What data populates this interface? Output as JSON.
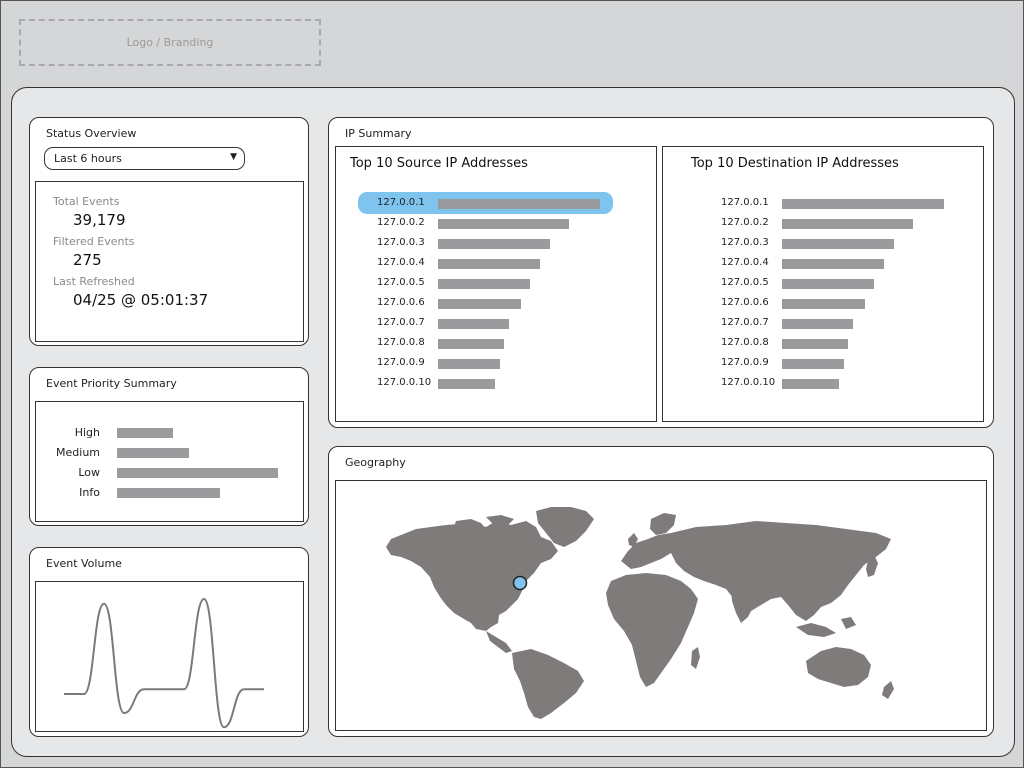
{
  "branding": {
    "logo_text": "Logo / Branding"
  },
  "status_overview": {
    "title": "Status Overview",
    "time_range": "Last 6 hours",
    "stats": [
      {
        "label": "Total Events",
        "value": "39,179"
      },
      {
        "label": "Filtered Events",
        "value": "275"
      },
      {
        "label": "Last Refreshed",
        "value": "04/25 @ 05:01:37"
      }
    ]
  },
  "event_priority": {
    "title": "Event Priority Summary",
    "items": [
      {
        "label": "High",
        "level": 0.35
      },
      {
        "label": "Medium",
        "level": 0.45
      },
      {
        "label": "Low",
        "level": 1.0
      },
      {
        "label": "Info",
        "level": 0.64
      }
    ]
  },
  "event_volume": {
    "title": "Event Volume",
    "series": [
      0,
      0,
      0.95,
      -0.2,
      0.05,
      0.05,
      0.05,
      1.0,
      -0.35,
      0.05,
      0.05
    ]
  },
  "ip_summary": {
    "title": "IP Summary",
    "source": {
      "title": "Top 10 Source IP Addresses",
      "selected_index": 0,
      "rows": [
        {
          "ip": "127.0.0.1",
          "value": 1.0
        },
        {
          "ip": "127.0.0.2",
          "value": 0.81
        },
        {
          "ip": "127.0.0.3",
          "value": 0.69
        },
        {
          "ip": "127.0.0.4",
          "value": 0.63
        },
        {
          "ip": "127.0.0.5",
          "value": 0.57
        },
        {
          "ip": "127.0.0.6",
          "value": 0.51
        },
        {
          "ip": "127.0.0.7",
          "value": 0.44
        },
        {
          "ip": "127.0.0.8",
          "value": 0.41
        },
        {
          "ip": "127.0.0.9",
          "value": 0.38
        },
        {
          "ip": "127.0.0.10",
          "value": 0.35
        }
      ]
    },
    "destination": {
      "title": "Top 10 Destination IP Addresses",
      "rows": [
        {
          "ip": "127.0.0.1",
          "value": 1.0
        },
        {
          "ip": "127.0.0.2",
          "value": 0.81
        },
        {
          "ip": "127.0.0.3",
          "value": 0.69
        },
        {
          "ip": "127.0.0.4",
          "value": 0.63
        },
        {
          "ip": "127.0.0.5",
          "value": 0.57
        },
        {
          "ip": "127.0.0.6",
          "value": 0.51
        },
        {
          "ip": "127.0.0.7",
          "value": 0.44
        },
        {
          "ip": "127.0.0.8",
          "value": 0.41
        },
        {
          "ip": "127.0.0.9",
          "value": 0.38
        },
        {
          "ip": "127.0.0.10",
          "value": 0.35
        }
      ]
    }
  },
  "geography": {
    "title": "Geography",
    "map_color": "#7f7b7b",
    "marker_color": "#7fc4ef"
  }
}
